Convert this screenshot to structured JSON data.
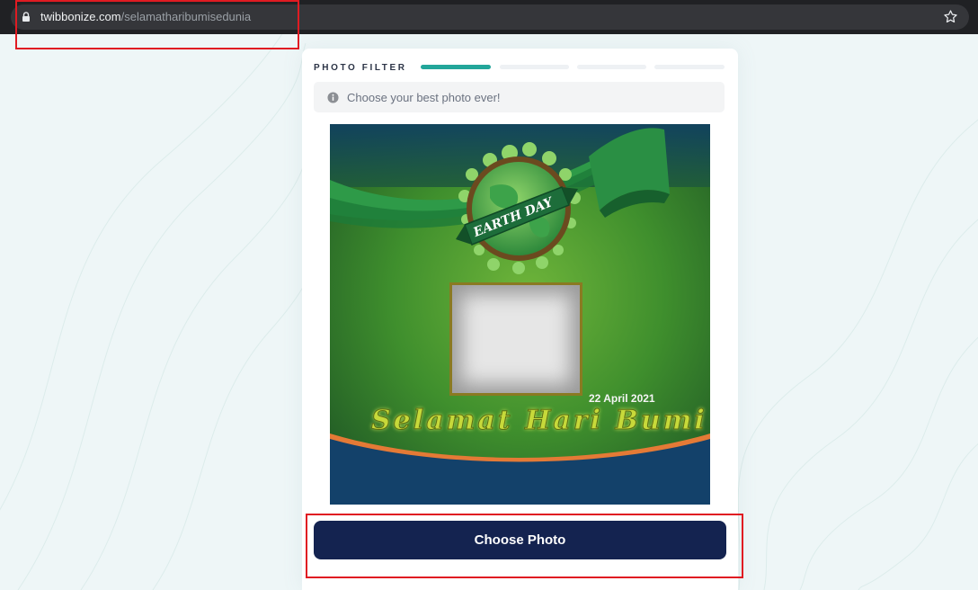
{
  "browser": {
    "url_host": "twibbonize.com",
    "url_path": "/selamatharibumisedunia",
    "icons": [
      "lock-icon",
      "bookmark-star-icon"
    ]
  },
  "card": {
    "step_label": "PHOTO FILTER",
    "steps_total": 4,
    "steps_active": 1,
    "info_text": "Choose your best photo ever!",
    "info_icon": "info-icon"
  },
  "frame": {
    "badge_text": "EARTH DAY",
    "date_text": "22 April 2021",
    "greeting_text": "Selamat Hari Bumi"
  },
  "button": {
    "label": "Choose Photo"
  },
  "colors": {
    "accent_teal": "#23a69a",
    "button_navy": "#142350",
    "highlight_red": "#e01b22",
    "frame_green": "#3f8f2d",
    "frame_blue": "#0f3f63"
  }
}
